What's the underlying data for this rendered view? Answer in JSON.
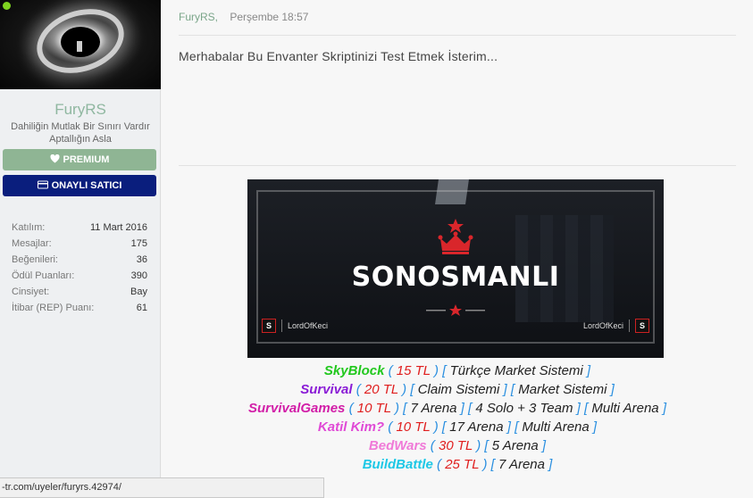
{
  "sidebar": {
    "username": "FuryRS",
    "user_title": "Dahiliğin Mutlak Bir Sınırı Vardır Aptallığın Asla",
    "premium_label": "PREMIUM",
    "seller_label": "ONAYLI SATICI",
    "stats": [
      {
        "label": "Katılım:",
        "value": "11 Mart 2016"
      },
      {
        "label": "Mesajlar:",
        "value": "175"
      },
      {
        "label": "Beğenileri:",
        "value": "36"
      },
      {
        "label": "Ödül Puanları:",
        "value": "390"
      },
      {
        "label": "Cinsiyet:",
        "value": "Bay"
      },
      {
        "label": "İtibar (REP) Puanı:",
        "value": "61"
      }
    ]
  },
  "post": {
    "author": "FuryRS,",
    "time": "Perşembe 18:57",
    "message": "Merhabalar Bu Envanter Skriptinizi Test Etmek İsterim..."
  },
  "banner": {
    "title": "SONOSMANLI",
    "tag_left": "LordOfKeci",
    "tag_right": "LordOfKeci",
    "s_letter": "S"
  },
  "games": [
    {
      "name": "SkyBlock",
      "color": "#22c81e",
      "price": "15 TL",
      "items": [
        "Türkçe Market Sistemi"
      ]
    },
    {
      "name": "Survival",
      "color": "#8a1cd6",
      "price": "20 TL",
      "items": [
        "Claim Sistemi",
        "Market Sistemi"
      ]
    },
    {
      "name": "SurvivalGames",
      "color": "#d21ea8",
      "price": "10 TL",
      "items": [
        "7 Arena",
        "4 Solo + 3 Team",
        "Multi Arena"
      ]
    },
    {
      "name": "Katil Kim?",
      "color": "#e04ad6",
      "price": "10 TL",
      "items": [
        "17 Arena",
        "Multi Arena"
      ]
    },
    {
      "name": "BedWars",
      "color": "#f07ad8",
      "price": "30 TL",
      "items": [
        "5 Arena"
      ]
    },
    {
      "name": "BuildBattle",
      "color": "#1ec8e6",
      "price": "25 TL",
      "items": [
        "7 Arena"
      ]
    }
  ],
  "statusbar": {
    "url": "-tr.com/uyeler/furyrs.42974/"
  }
}
